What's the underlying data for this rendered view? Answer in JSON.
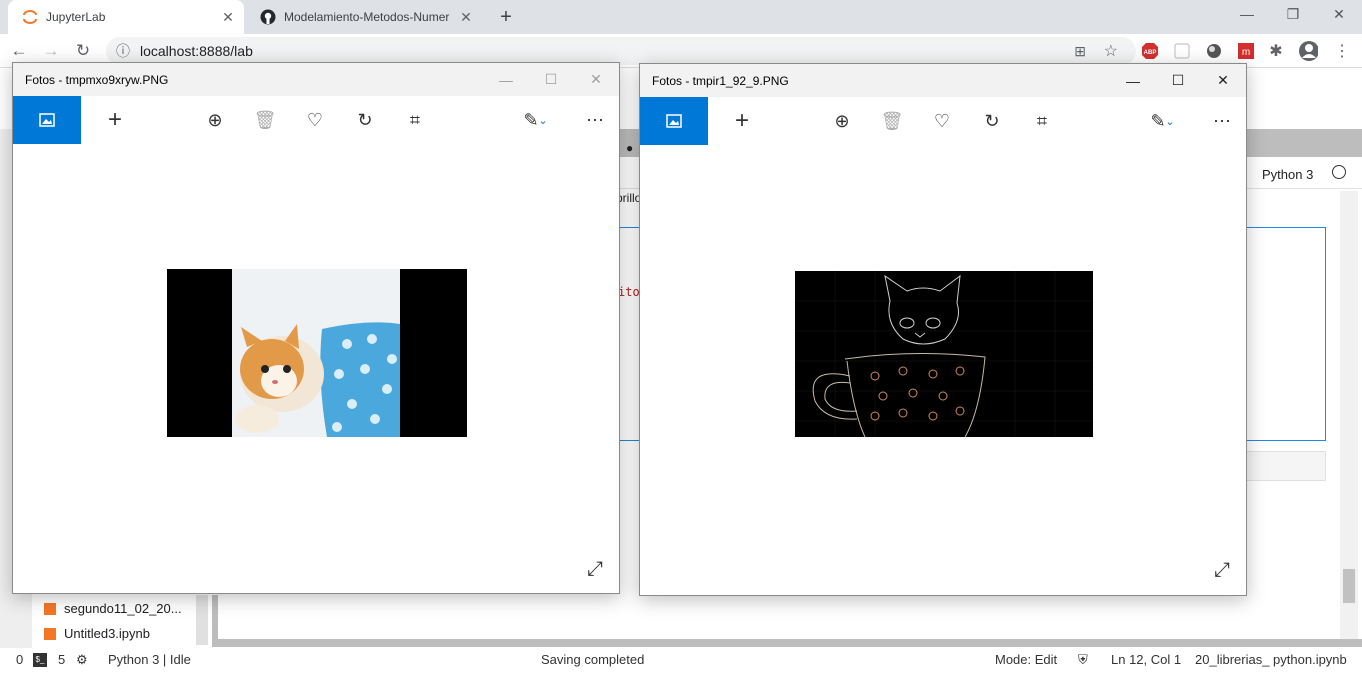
{
  "browser": {
    "tabs": [
      {
        "label": "JupyterLab",
        "active": true
      },
      {
        "label": "Modelamiento-Metodos-Numer",
        "active": false
      }
    ],
    "new_tab": "+",
    "url": "localhost:8888/lab"
  },
  "jupyter": {
    "kernel_label": "Python 3",
    "cell_text_1": "brillo",
    "cell_text_2": "ito",
    "files": [
      {
        "name": "segundo11_02_20..."
      },
      {
        "name": "Untitled3.ipynb"
      }
    ]
  },
  "statusbar": {
    "terminals": "0",
    "kernels": "5",
    "kernel_status": "Python 3 | Idle",
    "message": "Saving completed",
    "mode": "Mode: Edit",
    "position": "Ln 12, Col 1",
    "filename": "20_librerias_ python.ipynb"
  },
  "photos_windows": [
    {
      "title": "Fotos - tmpmxo9xryw.PNG",
      "active": false,
      "image": "kitten-in-blue-cup-original"
    },
    {
      "title": "Fotos - tmpir1_92_9.PNG",
      "active": true,
      "image": "kitten-in-cup-edge-detected"
    }
  ],
  "colors": {
    "accent": "#0078d7",
    "chrome_bg": "#dee1e6",
    "jupyter_orange": "#f37726"
  }
}
